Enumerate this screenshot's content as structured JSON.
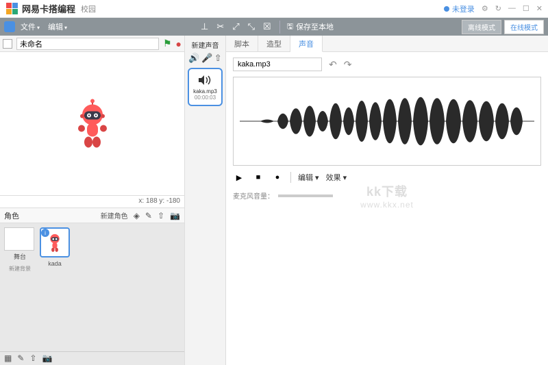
{
  "title": {
    "app": "网易卡搭编程",
    "sub": "校园",
    "login": "未登录"
  },
  "menu": {
    "file": "文件",
    "edit": "编辑",
    "save": "保存至本地",
    "offline": "离线模式",
    "online": "在线模式"
  },
  "stage": {
    "project_name": "未命名",
    "coords": "x: 188  y: -180"
  },
  "sprite": {
    "section": "角色",
    "new_label": "新建角色",
    "selected_name": "kada",
    "stage_label": "舞台",
    "bg_label": "新建背景"
  },
  "mid": {
    "section": "新建声音",
    "sound_name": "kaka.mp3",
    "sound_duration": "00:00:03"
  },
  "tabs": {
    "t1": "脚本",
    "t2": "造型",
    "t3": "声音"
  },
  "editor": {
    "filename": "kaka.mp3",
    "edit_menu": "编辑",
    "fx_menu": "效果",
    "mic_label": "麦克风音量："
  },
  "watermark": {
    "brand": "kk下载",
    "url": "www.kkx.net"
  }
}
